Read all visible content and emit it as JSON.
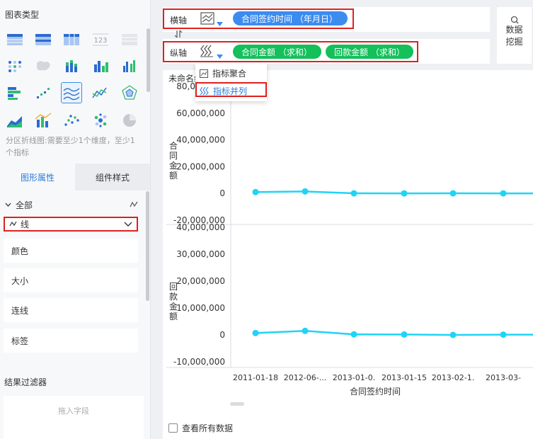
{
  "left_panel": {
    "chart_types_title": "图表类型",
    "chart_type_icons": [
      "table-icon",
      "grouped-table-icon",
      "cross-table-icon",
      "kpi-number-icon",
      "detail-table-icon",
      "dot-matrix-icon",
      "map-icon",
      "stacked-bar-icon",
      "bar-chart-icon",
      "column-chart-icon",
      "horizontal-bar-icon",
      "scatter-trend-icon",
      "partition-line-icon",
      "line-chart-icon",
      "radar-icon",
      "area-chart-icon",
      "combo-chart-icon",
      "scatter-icon",
      "bubble-icon",
      "pie-icon"
    ],
    "kpi_text": "123",
    "hint": "分区折线图:需要至少1个维度，至少1个指标",
    "tabs": [
      "图形属性",
      "组件样式"
    ],
    "all_label": "全部",
    "line_label": "线",
    "properties": [
      "颜色",
      "大小",
      "连线",
      "标签"
    ],
    "filter_title": "结果过滤器",
    "drop_placeholder": "拖入字段"
  },
  "axes": {
    "x_label": "横轴",
    "x_field": "合同签约时间  （年月日）",
    "y_label": "纵轴",
    "y_fields": [
      "合同金额  （求和）",
      "回款金额  （求和）"
    ],
    "swap_icon": "swap-icon"
  },
  "mining": {
    "line1": "数据",
    "line2": "挖掘"
  },
  "dropdown": {
    "items": [
      "指标聚合",
      "指标并列"
    ]
  },
  "chart": {
    "title": "未命名组件",
    "show_all_label": "查看所有数据"
  },
  "colors": {
    "accent": "#3c8cf0",
    "green": "#13c05a",
    "line": "#1fd4f5",
    "highlight": "#e02020"
  },
  "chart_data": [
    {
      "type": "line",
      "title": "未命名组件",
      "ylabel": "合同金额",
      "xlabel": "合同签约时间",
      "y_ticks": [
        "80,000,000",
        "60,000,000",
        "40,000,000",
        "20,000,000",
        "0",
        "-20,000,000"
      ],
      "ylim": [
        -20000000,
        80000000
      ],
      "x": [
        "2011-01-18",
        "2012-06-...",
        "2013-01-0.",
        "2013-01-15",
        "2013-02-1.",
        "2013-03-"
      ],
      "series": [
        {
          "values": [
            1000000,
            1500000,
            100000,
            50000,
            80000,
            60000
          ]
        }
      ]
    },
    {
      "type": "line",
      "ylabel": "回款金额",
      "xlabel": "合同签约时间",
      "y_ticks": [
        "40,000,000",
        "30,000,000",
        "20,000,000",
        "10,000,000",
        "0",
        "-10,000,000"
      ],
      "ylim": [
        -10000000,
        40000000
      ],
      "x": [
        "2011-01-18",
        "2012-06-...",
        "2013-01-0.",
        "2013-01-15",
        "2013-02-1.",
        "2013-03-"
      ],
      "series": [
        {
          "values": [
            700000,
            1500000,
            200000,
            150000,
            0,
            100000
          ]
        }
      ]
    }
  ]
}
